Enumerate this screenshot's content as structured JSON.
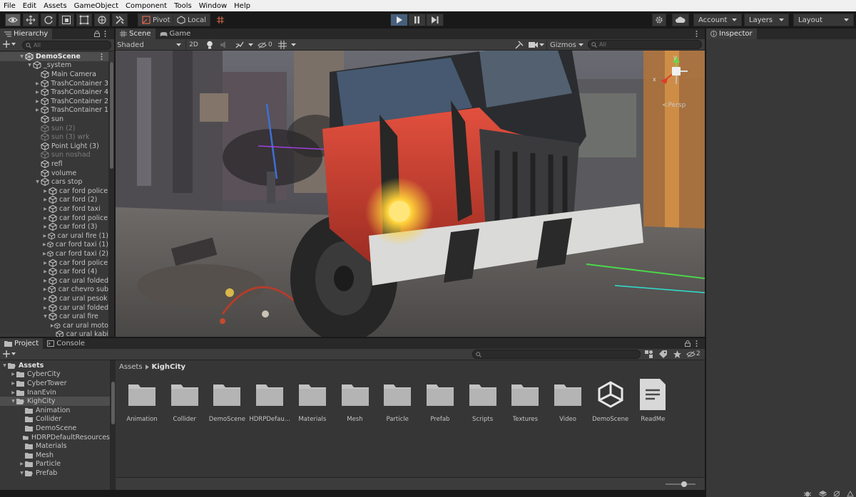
{
  "menu": [
    "File",
    "Edit",
    "Assets",
    "GameObject",
    "Component",
    "Tools",
    "Window",
    "Help"
  ],
  "toolbar": {
    "pivot_label": "Pivot",
    "local_label": "Local",
    "account_label": "Account",
    "layers_label": "Layers",
    "layout_label": "Layout"
  },
  "hierarchy": {
    "tab_label": "Hierarchy",
    "search_placeholder": "All",
    "scene_name": "DemoScene",
    "items": [
      {
        "label": "_system",
        "depth": 1,
        "arrow": "open",
        "dim": false
      },
      {
        "label": "Main Camera",
        "depth": 2,
        "arrow": "none",
        "dim": false
      },
      {
        "label": "TrashContainer 3",
        "depth": 2,
        "arrow": "closed",
        "dim": false
      },
      {
        "label": "TrashContainer 4",
        "depth": 2,
        "arrow": "closed",
        "dim": false
      },
      {
        "label": "TrashContainer 2",
        "depth": 2,
        "arrow": "closed",
        "dim": false
      },
      {
        "label": "TrashContainer 1",
        "depth": 2,
        "arrow": "closed",
        "dim": false
      },
      {
        "label": "sun",
        "depth": 2,
        "arrow": "none",
        "dim": false
      },
      {
        "label": "sun (2)",
        "depth": 2,
        "arrow": "none",
        "dim": true
      },
      {
        "label": "sun (3) wrk",
        "depth": 2,
        "arrow": "none",
        "dim": true
      },
      {
        "label": "Point Light (3)",
        "depth": 2,
        "arrow": "none",
        "dim": false
      },
      {
        "label": "sun noshad",
        "depth": 2,
        "arrow": "none",
        "dim": true
      },
      {
        "label": "refl",
        "depth": 2,
        "arrow": "none",
        "dim": false
      },
      {
        "label": "volume",
        "depth": 2,
        "arrow": "none",
        "dim": false
      },
      {
        "label": "cars stop",
        "depth": 2,
        "arrow": "open",
        "dim": false
      },
      {
        "label": "car ford police",
        "depth": 3,
        "arrow": "closed",
        "dim": false
      },
      {
        "label": "car ford (2)",
        "depth": 3,
        "arrow": "closed",
        "dim": false
      },
      {
        "label": "car ford taxi",
        "depth": 3,
        "arrow": "closed",
        "dim": false
      },
      {
        "label": "car ford police",
        "depth": 3,
        "arrow": "closed",
        "dim": false
      },
      {
        "label": "car ford (3)",
        "depth": 3,
        "arrow": "closed",
        "dim": false
      },
      {
        "label": "car ural fire (1)",
        "depth": 3,
        "arrow": "closed",
        "dim": false
      },
      {
        "label": "car ford taxi (1)",
        "depth": 3,
        "arrow": "closed",
        "dim": false
      },
      {
        "label": "car ford taxi (2)",
        "depth": 3,
        "arrow": "closed",
        "dim": false
      },
      {
        "label": "car ford police",
        "depth": 3,
        "arrow": "closed",
        "dim": false
      },
      {
        "label": "car ford (4)",
        "depth": 3,
        "arrow": "closed",
        "dim": false
      },
      {
        "label": "car ural folded",
        "depth": 3,
        "arrow": "closed",
        "dim": false
      },
      {
        "label": "car chevro sub",
        "depth": 3,
        "arrow": "closed",
        "dim": false
      },
      {
        "label": "car ural pesok",
        "depth": 3,
        "arrow": "closed",
        "dim": false
      },
      {
        "label": "car ural folded",
        "depth": 3,
        "arrow": "closed",
        "dim": false
      },
      {
        "label": "car ural fire",
        "depth": 3,
        "arrow": "open",
        "dim": false
      },
      {
        "label": "car ural moto",
        "depth": 4,
        "arrow": "closed",
        "dim": false
      },
      {
        "label": "car ural kabi",
        "depth": 4,
        "arrow": "none",
        "dim": false
      }
    ]
  },
  "scene": {
    "tab_scene": "Scene",
    "tab_game": "Game",
    "shading_mode": "Shaded",
    "mode_2d": "2D",
    "hidden_count": "0",
    "gizmos_label": "Gizmos",
    "search_placeholder": "All",
    "gizmo_y": "y",
    "gizmo_x": "x",
    "persp_label": "Persp"
  },
  "inspector": {
    "tab_label": "Inspector"
  },
  "project": {
    "tab_project": "Project",
    "tab_console": "Console",
    "hidden_count": "2",
    "tree": [
      {
        "label": "Assets",
        "depth": 0,
        "arrow": "open",
        "bold": true
      },
      {
        "label": "CyberCity",
        "depth": 1,
        "arrow": "closed"
      },
      {
        "label": "CyberTower",
        "depth": 1,
        "arrow": "closed"
      },
      {
        "label": "InanEvin",
        "depth": 1,
        "arrow": "closed"
      },
      {
        "label": "KighCity",
        "depth": 1,
        "arrow": "open",
        "sel": true
      },
      {
        "label": "Animation",
        "depth": 2,
        "arrow": "none"
      },
      {
        "label": "Collider",
        "depth": 2,
        "arrow": "none"
      },
      {
        "label": "DemoScene",
        "depth": 2,
        "arrow": "none"
      },
      {
        "label": "HDRPDefaultResources",
        "depth": 2,
        "arrow": "none"
      },
      {
        "label": "Materials",
        "depth": 2,
        "arrow": "none"
      },
      {
        "label": "Mesh",
        "depth": 2,
        "arrow": "none"
      },
      {
        "label": "Particle",
        "depth": 2,
        "arrow": "closed"
      },
      {
        "label": "Prefab",
        "depth": 2,
        "arrow": "open"
      }
    ],
    "breadcrumb": [
      "Assets",
      "KighCity"
    ],
    "assets": [
      {
        "label": "Animation",
        "kind": "folder"
      },
      {
        "label": "Collider",
        "kind": "folder"
      },
      {
        "label": "DemoScene",
        "kind": "folder"
      },
      {
        "label": "HDRPDefau...",
        "kind": "folder"
      },
      {
        "label": "Materials",
        "kind": "folder"
      },
      {
        "label": "Mesh",
        "kind": "folder"
      },
      {
        "label": "Particle",
        "kind": "folder"
      },
      {
        "label": "Prefab",
        "kind": "folder"
      },
      {
        "label": "Scripts",
        "kind": "folder"
      },
      {
        "label": "Textures",
        "kind": "folder"
      },
      {
        "label": "Video",
        "kind": "folder"
      },
      {
        "label": "DemoScene",
        "kind": "unity-scene"
      },
      {
        "label": "ReadMe",
        "kind": "document"
      }
    ]
  },
  "colors": {
    "editor_bg": "#383838",
    "play_active": "#46607c",
    "truck_red": "#c9382b",
    "headlight": "#ffd23a"
  }
}
